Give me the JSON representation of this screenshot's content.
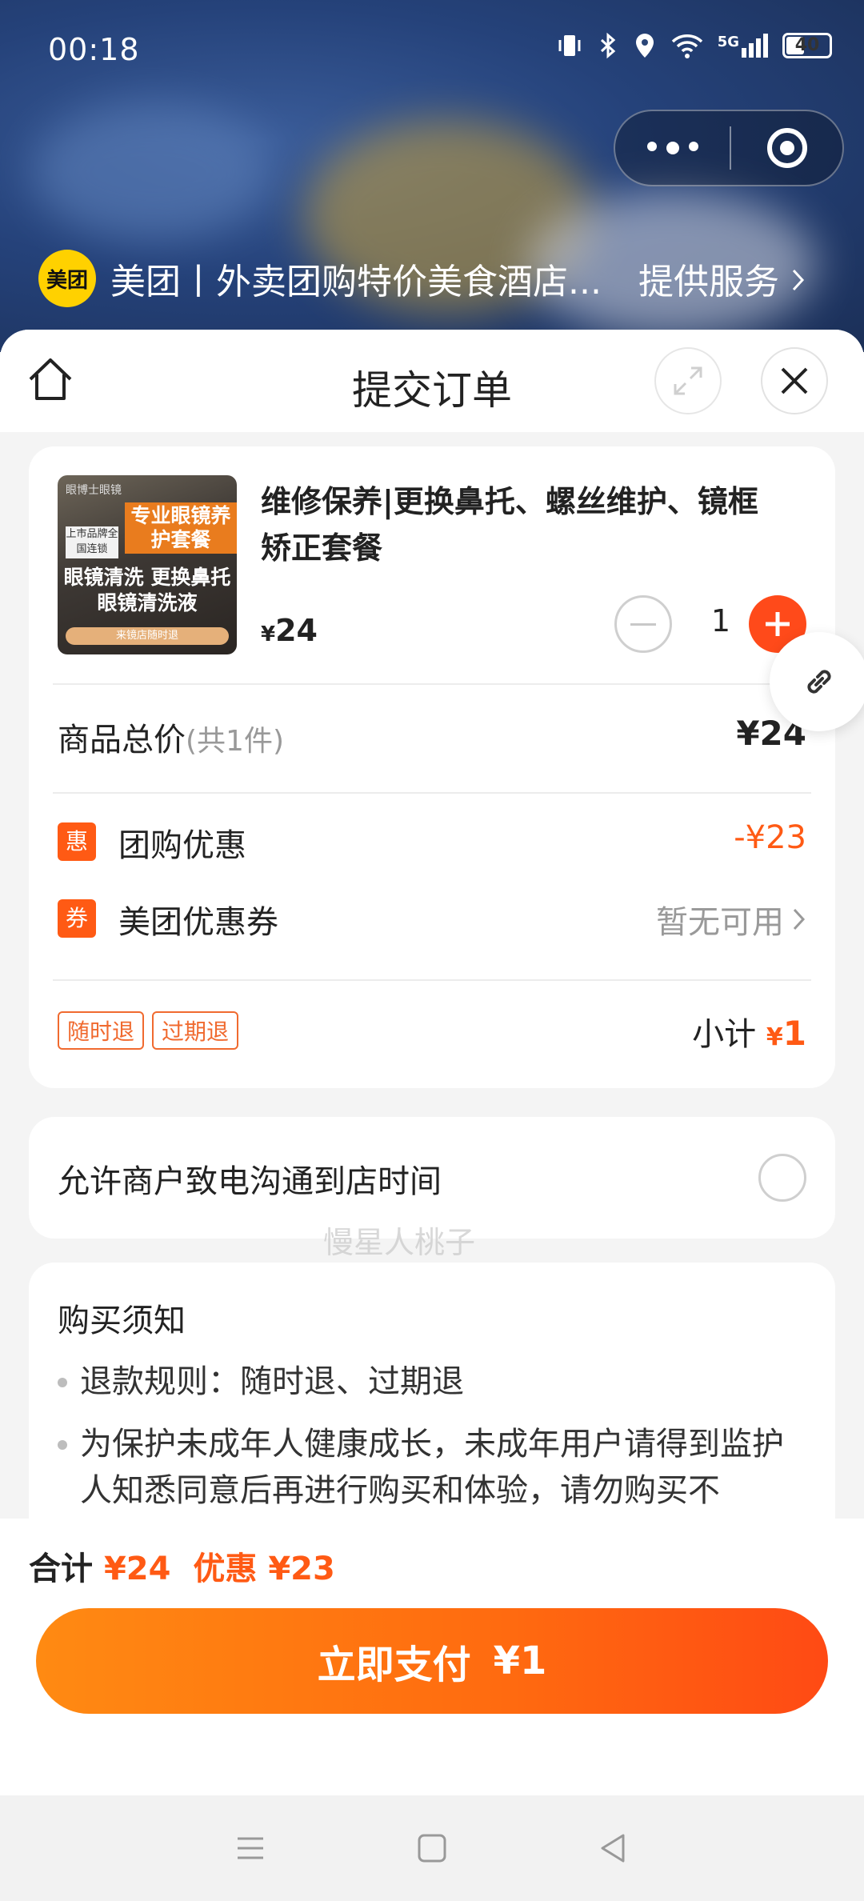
{
  "status_bar": {
    "time": "00:18",
    "network": "5G",
    "battery": "40"
  },
  "mini_program": {
    "logo_text": "美团",
    "title": "美团丨外卖团购特价美食酒店...",
    "service_link": "提供服务"
  },
  "sheet": {
    "title": "提交订单"
  },
  "product": {
    "thumb": {
      "brand": "眼博士眼镜",
      "banner": "专业眼镜养护套餐",
      "side_label": "上市品牌全国连锁",
      "services": "眼镜清洗 更换鼻托 眼镜清洗液",
      "pill": "来镜店随时退"
    },
    "name": "维修保养|更换鼻托、螺丝维护、镜框矫正套餐",
    "currency": "¥",
    "price": "24",
    "quantity": "1"
  },
  "summary": {
    "total_label": "商品总价",
    "count_label": "(共1件)",
    "total_value": "¥24",
    "group_icon": "惠",
    "group_label": "团购优惠",
    "group_value": "-¥23",
    "coupon_icon": "券",
    "coupon_label": "美团优惠券",
    "coupon_value": "暂无可用",
    "badges": [
      "随时退",
      "过期退"
    ],
    "subtotal_label": "小计",
    "subtotal_currency": "¥",
    "subtotal_value": "1"
  },
  "contact": {
    "label": "允许商户致电沟通到店时间"
  },
  "notice": {
    "title": "购买须知",
    "items": [
      "退款规则：随时退、过期退",
      "为保护未成年人健康成长，未成年用户请得到监护人知悉同意后再进行购买和体验，请勿购买不"
    ]
  },
  "watermark": "慢星人桃子",
  "paybar": {
    "total_label": "合计",
    "total_value": "¥24",
    "discount_label": "优惠",
    "discount_value": "¥23",
    "pay_label": "立即支付",
    "pay_amount": "¥1"
  },
  "colors": {
    "accent": "#ff5a14",
    "pay_start": "#ff8a12",
    "pay_end": "#ff4a14",
    "logo": "#ffd100"
  }
}
